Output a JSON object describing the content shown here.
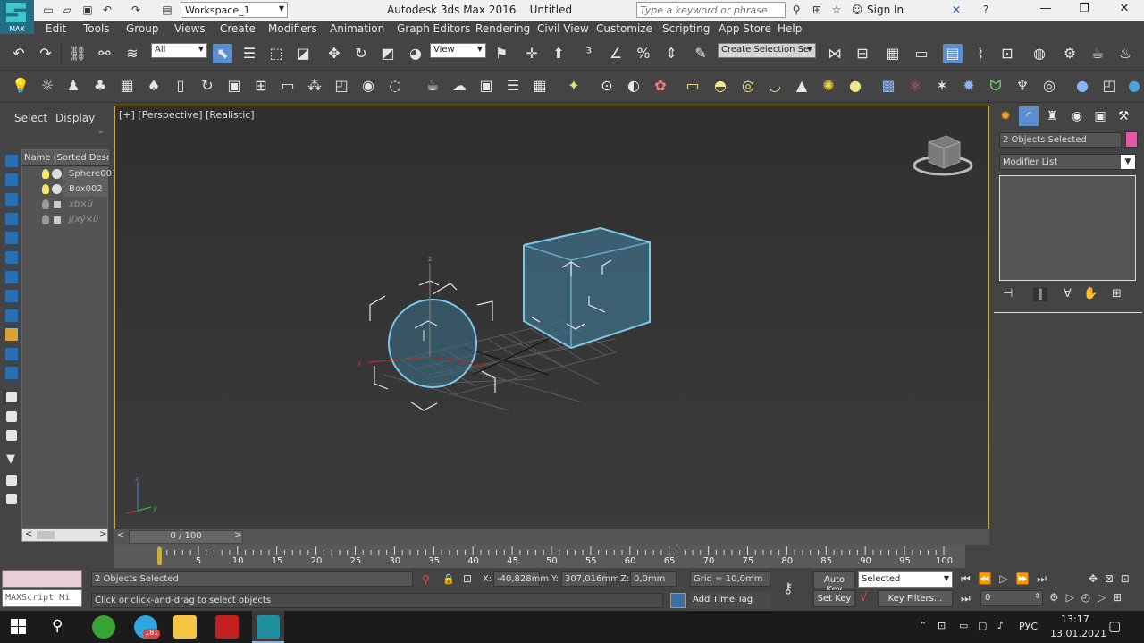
{
  "titlebar": {
    "logo_text": "MAX",
    "workspace": "Workspace_1",
    "app_title": "Autodesk 3ds Max 2016    Untitled",
    "search_placeholder": "Type a keyword or phrase",
    "sign_in": "Sign In"
  },
  "menu": [
    "Edit",
    "Tools",
    "Group",
    "Views",
    "Create",
    "Modifiers",
    "Animation",
    "Graph Editors",
    "Rendering",
    "Civil View",
    "Customize",
    "Scripting",
    "App Store",
    "Help"
  ],
  "main_toolbar": {
    "selection_filter": "All",
    "ref_coord": "View",
    "named_selection_placeholder": "Create Selection Se"
  },
  "left_panel": {
    "tabs": [
      "Select",
      "Display"
    ],
    "list_header": "Name (Sorted Desce",
    "rows": [
      {
        "name": "Sphere00",
        "selected": true
      },
      {
        "name": "Box002",
        "selected": true
      },
      {
        "name": "xb×ü",
        "selected": false
      },
      {
        "name": "j(xý×ü",
        "selected": false
      }
    ]
  },
  "viewport": {
    "label": "[+] [Perspective] [Realistic]",
    "accent_color": "#c9a93a",
    "selection_color": "#7cc7e8"
  },
  "right_panel": {
    "selection_text": "2 Objects Selected",
    "object_color": "#e257a8",
    "modifier_list": "Modifier List"
  },
  "timeline": {
    "slider_text": "0 / 100",
    "ticks": [
      "5",
      "10",
      "15",
      "20",
      "25",
      "30",
      "35",
      "40",
      "45",
      "50",
      "55",
      "60",
      "65",
      "70",
      "75",
      "80",
      "85",
      "90",
      "95",
      "100"
    ]
  },
  "status": {
    "maxscript": "MAXScript Mi",
    "selection_msg": "2 Objects Selected",
    "prompt": "Click or click-and-drag to select objects",
    "x_label": "X:",
    "x_value": "-40,828mm",
    "y_label": "Y:",
    "y_value": "307,016mm",
    "z_label": "Z:",
    "z_value": "0,0mm",
    "grid": "Grid = 10,0mm",
    "add_time_tag": "Add Time Tag",
    "auto_key": "Auto Key",
    "set_key": "Set Key",
    "key_mode": "Selected",
    "key_filters": "Key Filters...",
    "frame": "0"
  },
  "taskbar": {
    "telegram_badge": "181",
    "lang": "РУС",
    "time": "13:17",
    "date": "13.01.2021"
  }
}
